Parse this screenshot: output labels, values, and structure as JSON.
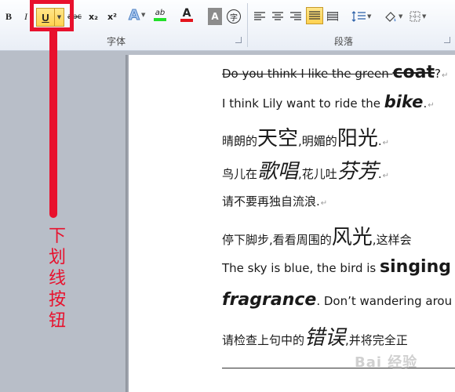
{
  "ribbon": {
    "font_group": {
      "label": "字体",
      "bold": "B",
      "italic": "I",
      "underline": "U",
      "strike": "abc",
      "subscript": "x₂",
      "superscript": "x²",
      "text_effects": "A",
      "highlight": "ab",
      "font_color": "A",
      "char_shading": "A",
      "enclose": "字"
    },
    "paragraph_group": {
      "label": "段落"
    }
  },
  "annotation": {
    "label": "下划线按钮",
    "color": "#e8112d"
  },
  "document": {
    "line1": {
      "pre": "Do you think I like the green ",
      "big": "coat",
      "post": "?"
    },
    "line2": {
      "pre": "I think Lily want to ride the ",
      "big": "bike",
      "post": "."
    },
    "line3": {
      "a": "晴朗的",
      "b": "天空",
      "c": ",明媚的",
      "d": "阳光",
      "e": "."
    },
    "line4": {
      "a": "鸟儿在",
      "b": "歌唱",
      "c": ",花儿吐",
      "d": "芬芳",
      "e": "."
    },
    "line5": {
      "text": "请不要再独自流浪."
    },
    "line6": {
      "a": "停下脚步,看看周围的",
      "b": "风光",
      "c": ",这样会"
    },
    "line7": {
      "pre": "The sky is blue, the bird is ",
      "big": "singing"
    },
    "line8": {
      "big": "fragrance",
      "post": ". Don’t wandering arou"
    },
    "line9": {
      "a": "请检查上句中的",
      "b": "错误",
      "c": ",并将完全正"
    },
    "paragraph_mark": "↵"
  },
  "watermark": "Bai 经验"
}
